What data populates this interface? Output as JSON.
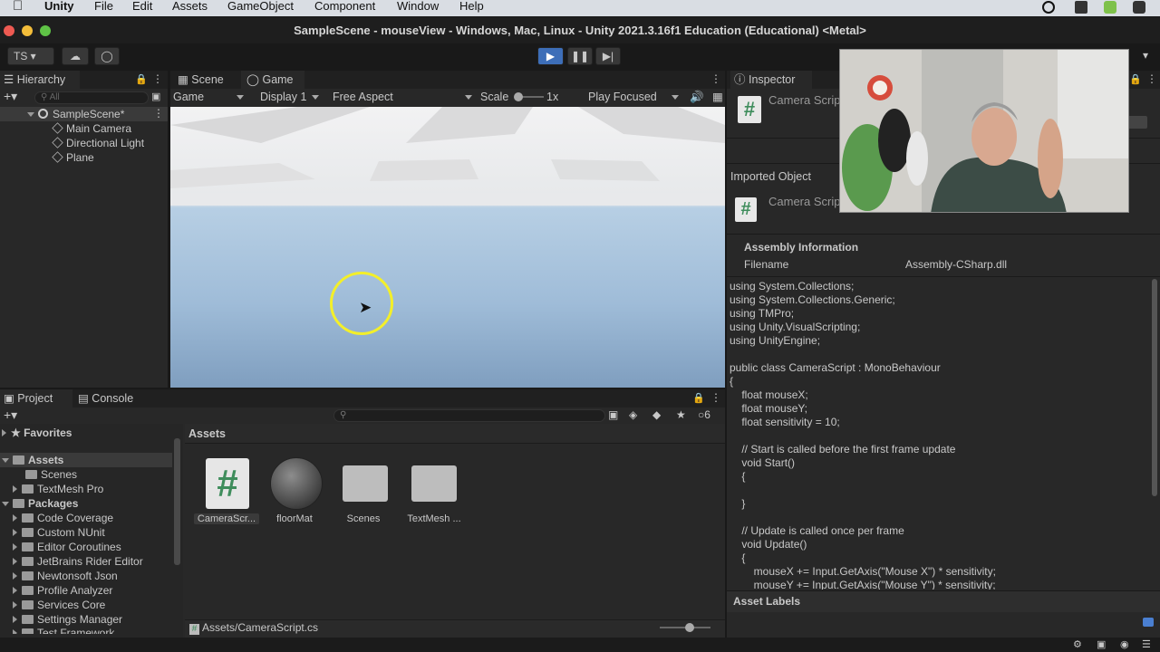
{
  "menubar": {
    "app": "Unity",
    "items": [
      "File",
      "Edit",
      "Assets",
      "GameObject",
      "Component",
      "Window",
      "Help"
    ]
  },
  "window": {
    "title": "SampleScene - mouseView - Windows, Mac, Linux - Unity 2021.3.16f1 Education (Educational) <Metal>"
  },
  "toolbar": {
    "account": "TS"
  },
  "hierarchy": {
    "tab": "Hierarchy",
    "search_placeholder": "All",
    "scene": "SampleScene*",
    "objects": [
      "Main Camera",
      "Directional Light",
      "Plane"
    ]
  },
  "game": {
    "tabs": [
      "Scene",
      "Game"
    ],
    "mode": "Game",
    "display": "Display 1",
    "aspect": "Free Aspect",
    "scale_label": "Scale",
    "scale_value": "1x",
    "play_focus": "Play Focused"
  },
  "inspector": {
    "tab": "Inspector",
    "header_name": "Camera Script",
    "imported_object": "Imported Object",
    "imported_name": "Camera Script",
    "assembly_title": "Assembly Information",
    "filename_label": "Filename",
    "filename_value": "Assembly-CSharp.dll",
    "code": "using System.Collections;\nusing System.Collections.Generic;\nusing TMPro;\nusing Unity.VisualScripting;\nusing UnityEngine;\n\npublic class CameraScript : MonoBehaviour\n{\n    float mouseX;\n    float mouseY;\n    float sensitivity = 10;\n\n    // Start is called before the first frame update\n    void Start()\n    {\n\n    }\n\n    // Update is called once per frame\n    void Update()\n    {\n        mouseX += Input.GetAxis(\"Mouse X\") * sensitivity;\n        mouseY += Input.GetAxis(\"Mouse Y\") * sensitivity;",
    "asset_labels": "Asset Labels"
  },
  "project": {
    "tabs": [
      "Project",
      "Console"
    ],
    "hidden_count": "6",
    "favorites": "Favorites",
    "assets_root": "Assets",
    "asset_folders": [
      "Scenes",
      "TextMesh Pro"
    ],
    "packages_root": "Packages",
    "packages": [
      "Code Coverage",
      "Custom NUnit",
      "Editor Coroutines",
      "JetBrains Rider Editor",
      "Newtonsoft Json",
      "Profile Analyzer",
      "Services Core",
      "Settings Manager",
      "Test Framework"
    ],
    "breadcrumb": "Assets",
    "grid_items": [
      "CameraScr...",
      "floorMat",
      "Scenes",
      "TextMesh ..."
    ],
    "status_path": "Assets/CameraScript.cs"
  },
  "colors": {
    "accent_play": "#3d6eb8",
    "cursor_ring": "#f3ef2a",
    "script_icon": "#3f8d5c"
  }
}
